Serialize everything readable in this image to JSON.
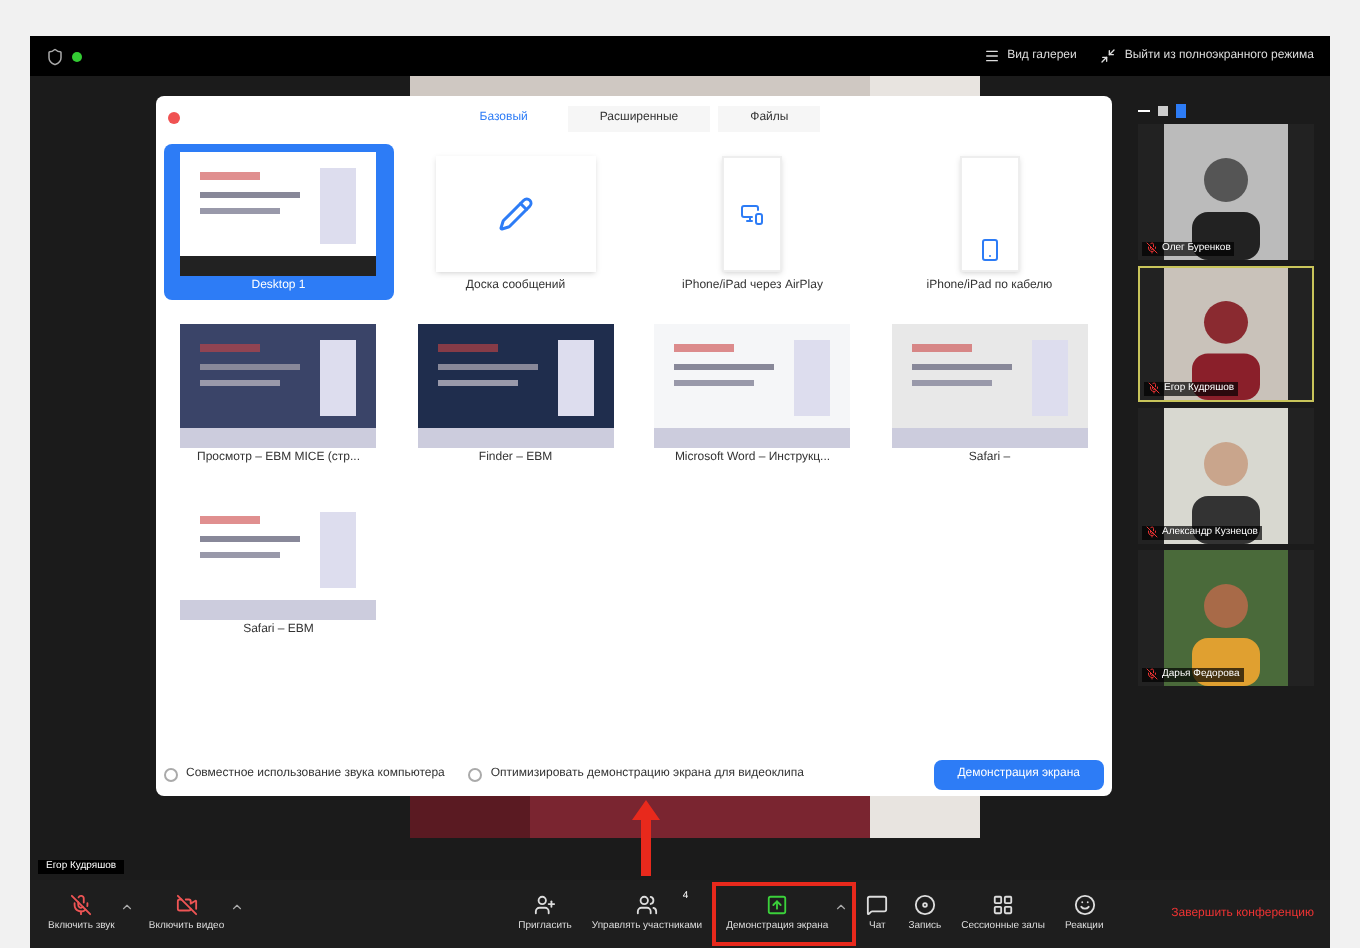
{
  "top_bar": {
    "view_button": "Вид галереи",
    "exit_fullscreen": "Выйти из полноэкранного режима"
  },
  "share_dialog": {
    "tabs": [
      {
        "label": "Базовый",
        "selected": true
      },
      {
        "label": "Расширенные",
        "selected": false
      },
      {
        "label": "Файлы",
        "selected": false
      }
    ],
    "sources": [
      {
        "label": "Desktop 1",
        "kind": "desktop",
        "selected": true
      },
      {
        "label": "Доска сообщений",
        "kind": "whiteboard",
        "selected": false
      },
      {
        "label": "iPhone/iPad через AirPlay",
        "kind": "airplay",
        "selected": false
      },
      {
        "label": "iPhone/iPad по кабелю",
        "kind": "cable",
        "selected": false
      },
      {
        "label": "Просмотр – EBM MICE (стр...",
        "kind": "window",
        "selected": false
      },
      {
        "label": "Finder – EBM",
        "kind": "window",
        "selected": false
      },
      {
        "label": "Microsoft Word – Инструкц...",
        "kind": "window",
        "selected": false
      },
      {
        "label": "Safari –",
        "kind": "window",
        "selected": false
      },
      {
        "label": "Safari – EBM",
        "kind": "window",
        "selected": false
      }
    ],
    "options": [
      {
        "label": "Совместное использование звука компьютера",
        "checked": false
      },
      {
        "label": "Оптимизировать демонстрацию экрана для видеоклипа",
        "checked": false
      }
    ],
    "share_button": "Демонстрация экрана"
  },
  "participants": [
    {
      "name": "Олег Буренков",
      "muted": true,
      "highlighted": false
    },
    {
      "name": "Егор Кудряшов",
      "muted": true,
      "highlighted": true
    },
    {
      "name": "Александр Кузнецов",
      "muted": true,
      "highlighted": false
    },
    {
      "name": "Дарья Федорова",
      "muted": true,
      "highlighted": false
    }
  ],
  "speaker_name": "Егор Кудряшов",
  "toolbar": {
    "items": [
      {
        "label": "Включить звук",
        "kind": "mic",
        "caret": true,
        "highlighted": false
      },
      {
        "label": "Включить видео",
        "kind": "video",
        "caret": true,
        "highlighted": false
      },
      {
        "label": "Пригласить",
        "kind": "invite",
        "caret": false,
        "highlighted": false
      },
      {
        "label": "Управлять участниками",
        "kind": "participants",
        "badge": "4",
        "caret": false,
        "highlighted": false
      },
      {
        "label": "Демонстрация экрана",
        "kind": "share",
        "caret": true,
        "highlighted": true
      },
      {
        "label": "Чат",
        "kind": "chat",
        "caret": false,
        "highlighted": false
      },
      {
        "label": "Запись",
        "kind": "record",
        "caret": false,
        "highlighted": false
      },
      {
        "label": "Сессионные залы",
        "kind": "rooms",
        "caret": false,
        "highlighted": false
      },
      {
        "label": "Реакции",
        "kind": "reactions",
        "caret": false,
        "highlighted": false
      }
    ],
    "end_button": "Завершить конференцию"
  }
}
